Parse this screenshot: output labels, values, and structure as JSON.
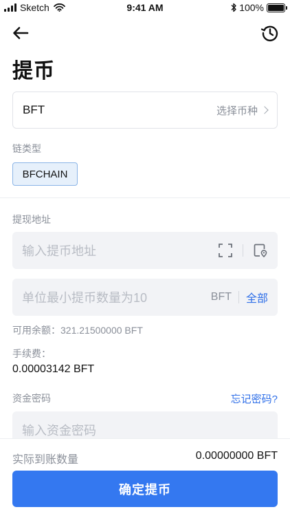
{
  "status_bar": {
    "carrier": "Sketch",
    "time": "9:41 AM",
    "battery": "100%",
    "battery_level": 1.0
  },
  "page": {
    "title": "提币"
  },
  "coin_select": {
    "value": "BFT",
    "choose_label": "选择币种"
  },
  "chain": {
    "label": "链类型",
    "selected": "BFCHAIN"
  },
  "address": {
    "label": "提现地址",
    "placeholder": "输入提币地址"
  },
  "amount": {
    "placeholder": "单位最小提币数量为10",
    "unit": "BFT",
    "all_label": "全部"
  },
  "balance": {
    "text": "可用余额：321.21500000 BFT"
  },
  "fee": {
    "label": "手续费：",
    "value": "0.00003142 BFT"
  },
  "fund_password": {
    "label": "资金密码",
    "forgot_label": "忘记密码?",
    "placeholder": "输入资金密码"
  },
  "receive": {
    "label": "实际到账数量",
    "value": "0.00000000 BFT"
  },
  "confirm": {
    "label": "确定提币"
  },
  "icons": {
    "back": "arrow-left-icon",
    "history": "history-icon",
    "scan": "scan-icon",
    "address_book": "address-book-icon",
    "chevron": "chevron-right-icon"
  }
}
